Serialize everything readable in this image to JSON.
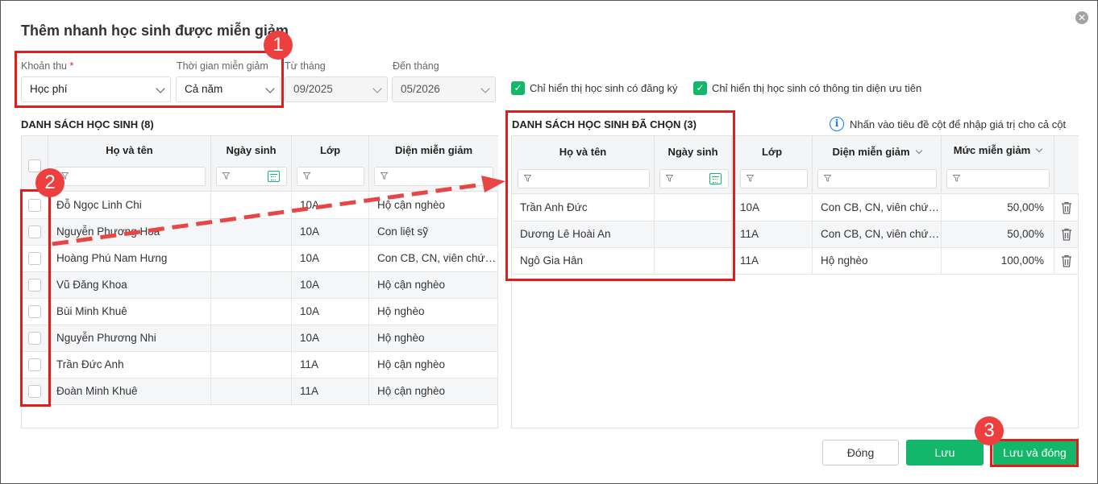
{
  "dialog": {
    "title": "Thêm nhanh học sinh được miễn giảm",
    "close_glyph": "✕"
  },
  "filters": {
    "khoan_thu_label": "Khoản thu",
    "required_mark": "*",
    "khoan_thu_value": "Học phí",
    "thoi_gian_label": "Thời gian miễn giảm",
    "thoi_gian_value": "Cả năm",
    "tu_thang_label": "Từ tháng",
    "tu_thang_value": "09/2025",
    "den_thang_label": "Đến tháng",
    "den_thang_value": "05/2026"
  },
  "options": {
    "check1": "Chỉ hiển thị học sinh có đăng ký",
    "check2": "Chỉ hiển thị học sinh có thông tin diện ưu tiên"
  },
  "left": {
    "heading": "DANH SÁCH HỌC SINH (8)",
    "headers": {
      "name": "Họ và tên",
      "dob": "Ngày sinh",
      "class": "Lớp",
      "exempt": "Diện miễn giảm"
    },
    "rows": [
      {
        "name": "Đỗ Ngọc Linh Chi",
        "dob": "",
        "class": "10A",
        "exempt": "Hộ cận nghèo"
      },
      {
        "name": "Nguyễn Phương Hoa",
        "dob": "",
        "class": "10A",
        "exempt": "Con liệt sỹ"
      },
      {
        "name": "Hoàng Phú Nam Hưng",
        "dob": "",
        "class": "10A",
        "exempt": "Con CB, CN, viên chức..."
      },
      {
        "name": "Vũ Đăng Khoa",
        "dob": "",
        "class": "10A",
        "exempt": "Hộ cận nghèo"
      },
      {
        "name": "Bùi Minh Khuê",
        "dob": "",
        "class": "10A",
        "exempt": "Hộ nghèo"
      },
      {
        "name": "Nguyễn Phương Nhi",
        "dob": "",
        "class": "10A",
        "exempt": "Hộ nghèo"
      },
      {
        "name": "Trần Đức Anh",
        "dob": "",
        "class": "11A",
        "exempt": "Hộ cận nghèo"
      },
      {
        "name": "Đoàn Minh Khuê",
        "dob": "",
        "class": "11A",
        "exempt": "Hộ cận nghèo"
      }
    ]
  },
  "right": {
    "heading": "DANH SÁCH HỌC SINH ĐÃ CHỌN (3)",
    "hint": "Nhấn vào tiêu đề cột để nhập giá trị cho cả cột",
    "info_glyph": "i",
    "headers": {
      "name": "Họ và tên",
      "dob": "Ngày sinh",
      "class": "Lớp",
      "exempt": "Diện miễn giảm",
      "rate": "Mức miễn giảm"
    },
    "rows": [
      {
        "name": "Trần Anh Đức",
        "dob": "",
        "class": "10A",
        "exempt": "Con CB, CN, viên chức...",
        "rate": "50,00%"
      },
      {
        "name": "Dương Lê Hoài An",
        "dob": "",
        "class": "11A",
        "exempt": "Con CB, CN, viên chức...",
        "rate": "50,00%"
      },
      {
        "name": "Ngô Gia Hân",
        "dob": "",
        "class": "11A",
        "exempt": "Hộ nghèo",
        "rate": "100,00%"
      }
    ]
  },
  "buttons": {
    "close": "Đóng",
    "save": "Lưu",
    "save_close": "Lưu và đóng"
  },
  "badges": [
    "1",
    "2",
    "3"
  ],
  "colors": {
    "accent": "#12b76a",
    "annotation": "#e21b1b",
    "badge": "#ee3f3f"
  }
}
